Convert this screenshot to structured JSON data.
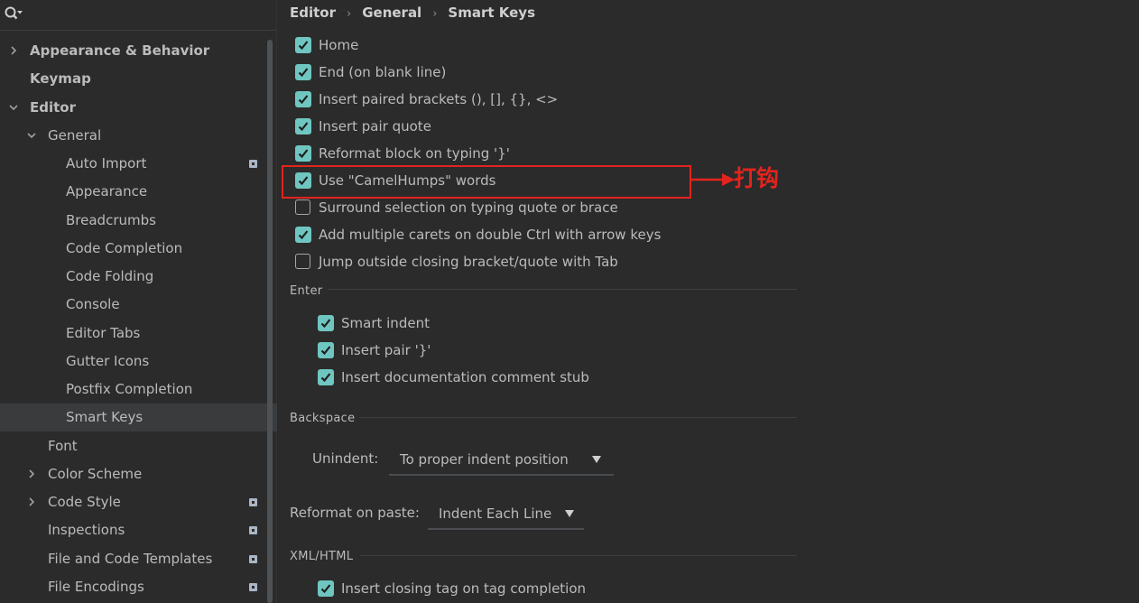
{
  "sidebar": {
    "items": [
      {
        "label": "Appearance & Behavior",
        "bold": true,
        "expanded": false,
        "has_badge": false
      },
      {
        "label": "Keymap",
        "bold": true,
        "has_badge": false
      },
      {
        "label": "Editor",
        "bold": true,
        "expanded": true,
        "has_badge": false
      },
      {
        "label": "General",
        "expanded": true,
        "has_badge": false
      },
      {
        "label": "Auto Import",
        "has_badge": true
      },
      {
        "label": "Appearance",
        "has_badge": false
      },
      {
        "label": "Breadcrumbs",
        "has_badge": false
      },
      {
        "label": "Code Completion",
        "has_badge": false
      },
      {
        "label": "Code Folding",
        "has_badge": false
      },
      {
        "label": "Console",
        "has_badge": false
      },
      {
        "label": "Editor Tabs",
        "has_badge": false
      },
      {
        "label": "Gutter Icons",
        "has_badge": false
      },
      {
        "label": "Postfix Completion",
        "has_badge": false
      },
      {
        "label": "Smart Keys",
        "selected": true,
        "has_badge": false
      },
      {
        "label": "Font",
        "has_badge": false
      },
      {
        "label": "Color Scheme",
        "expanded": false,
        "has_badge": false
      },
      {
        "label": "Code Style",
        "expanded": false,
        "has_badge": true
      },
      {
        "label": "Inspections",
        "has_badge": true
      },
      {
        "label": "File and Code Templates",
        "has_badge": true
      },
      {
        "label": "File Encodings",
        "has_badge": true
      }
    ]
  },
  "breadcrumb": [
    "Editor",
    "General",
    "Smart Keys"
  ],
  "smart_keys": [
    {
      "label": "Home",
      "checked": true
    },
    {
      "label": "End (on blank line)",
      "checked": true
    },
    {
      "label": "Insert paired brackets (), [], {}, <>",
      "checked": true
    },
    {
      "label": "Insert pair quote",
      "checked": true
    },
    {
      "label": "Reformat block on typing '}'",
      "checked": true
    },
    {
      "label": "Use \"CamelHumps\" words",
      "checked": true
    },
    {
      "label": "Surround selection on typing quote or brace",
      "checked": false
    },
    {
      "label": "Add multiple carets on double Ctrl with arrow keys",
      "checked": true
    },
    {
      "label": "Jump outside closing bracket/quote with Tab",
      "checked": false
    }
  ],
  "enter": {
    "title": "Enter",
    "options": [
      {
        "label": "Smart indent",
        "checked": true
      },
      {
        "label": "Insert pair '}'",
        "checked": true
      },
      {
        "label": "Insert documentation comment stub",
        "checked": true
      }
    ]
  },
  "backspace": {
    "title": "Backspace",
    "unindent_label": "Unindent:",
    "unindent_value": "To proper indent position"
  },
  "paste": {
    "label": "Reformat on paste:",
    "value": "Indent Each Line"
  },
  "xml": {
    "title": "XML/HTML",
    "options": [
      {
        "label": "Insert closing tag on tag completion",
        "checked": true
      }
    ]
  },
  "annotation": {
    "text": "打钩",
    "color": "#e3241d"
  },
  "colors": {
    "checkbox": "#6fc6c0",
    "background": "#2b2b2b",
    "selected": "#393b3d"
  }
}
